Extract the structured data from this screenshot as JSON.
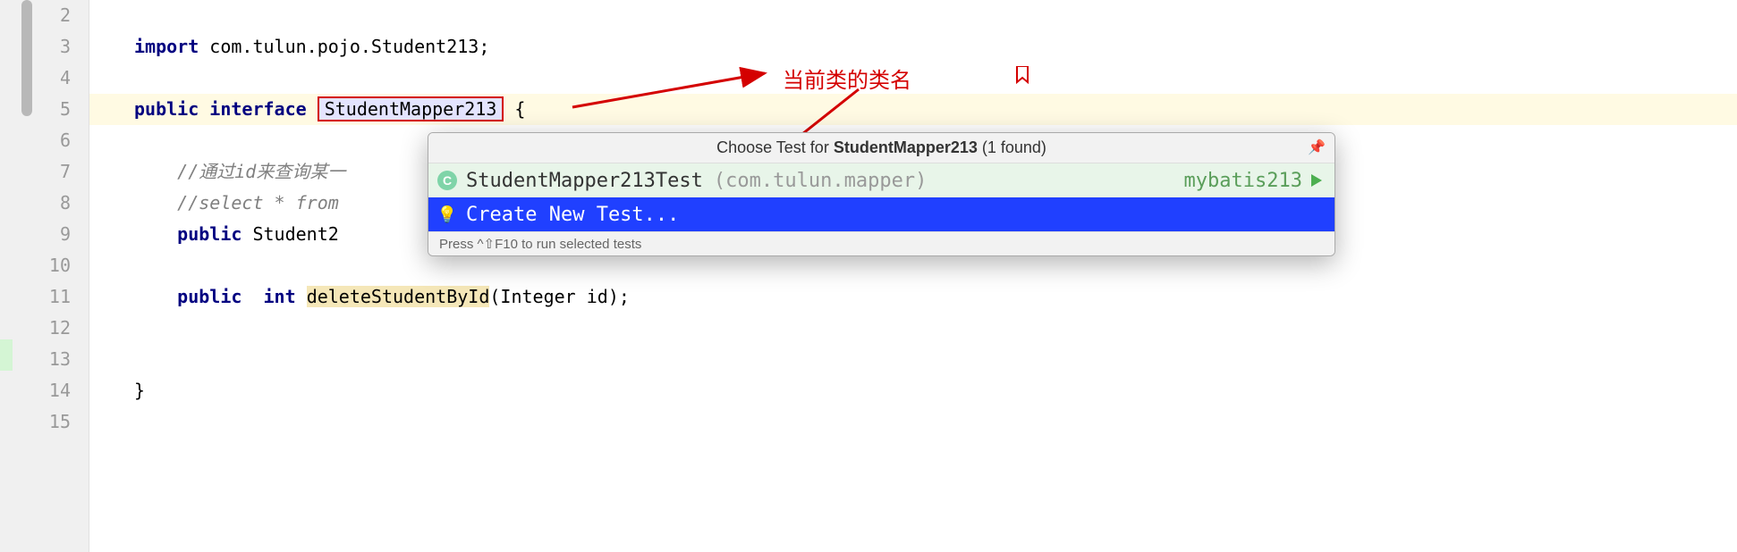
{
  "gutter": {
    "lines": [
      "2",
      "3",
      "4",
      "5",
      "6",
      "7",
      "8",
      "9",
      "10",
      "11",
      "12",
      "13",
      "14",
      "15"
    ]
  },
  "code": {
    "line2": "",
    "line3_kw": "import",
    "line3_rest": " com.tulun.pojo.Student213;",
    "line4": "",
    "line5_kw1": "public",
    "line5_kw2": "interface",
    "line5_class": "StudentMapper213",
    "line5_brace": " {",
    "line6": "",
    "line7_indent": "    ",
    "line7_comment": "//通过id来查询某一",
    "line8_indent": "    ",
    "line8_comment": "//select * from",
    "line9_indent": "    ",
    "line9_kw": "public",
    "line9_rest": " Student2",
    "line10": "",
    "line11_indent": "    ",
    "line11_kw1": "public",
    "line11_sp": "  ",
    "line11_kw2": "int",
    "line11_sp2": " ",
    "line11_method": "deleteStudentById",
    "line11_params": "(Integer id);",
    "line12": "",
    "line13": "",
    "line14": "}",
    "line15": ""
  },
  "annotation": {
    "label": "当前类的类名"
  },
  "popup": {
    "title_prefix": "Choose Test for ",
    "title_class": "StudentMapper213",
    "title_suffix": " (1 found)",
    "item1_name": "StudentMapper213Test",
    "item1_pkg": "(com.tulun.mapper)",
    "item1_module": "mybatis213",
    "item2_label": "Create New Test...",
    "footer": "Press ^⇧F10 to run selected tests"
  }
}
